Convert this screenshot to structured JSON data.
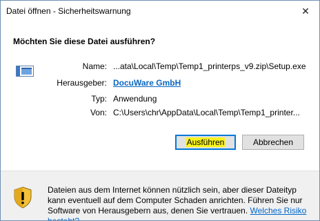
{
  "window": {
    "title": "Datei öffnen - Sicherheitswarnung",
    "close_glyph": "✕"
  },
  "question": "Möchten Sie diese Datei ausführen?",
  "details": {
    "name_label": "Name:",
    "name_value": "...ata\\Local\\Temp\\Temp1_printerps_v9.zip\\Setup.exe",
    "publisher_label": "Herausgeber:",
    "publisher_value": "DocuWare GmbH",
    "type_label": "Typ:",
    "type_value": "Anwendung",
    "from_label": "Von:",
    "from_value": "C:\\Users\\chr\\AppData\\Local\\Temp\\Temp1_printer..."
  },
  "buttons": {
    "run": "Ausführen",
    "cancel": "Abbrechen"
  },
  "footer": {
    "warning_text": "Dateien aus dem Internet können nützlich sein, aber dieser Dateityp kann eventuell auf dem Computer Schaden anrichten. Führen Sie nur Software von Herausgebern aus, denen Sie vertrauen. ",
    "risk_link": "Welches Risiko besteht?"
  },
  "icons": {
    "file": "application-window-icon",
    "warning": "warning-shield-icon"
  },
  "colors": {
    "link": "#0a66c2",
    "highlight": "#f8f41c",
    "footer_bg": "#f0f0f0",
    "button_border_focus": "#0078d7"
  }
}
